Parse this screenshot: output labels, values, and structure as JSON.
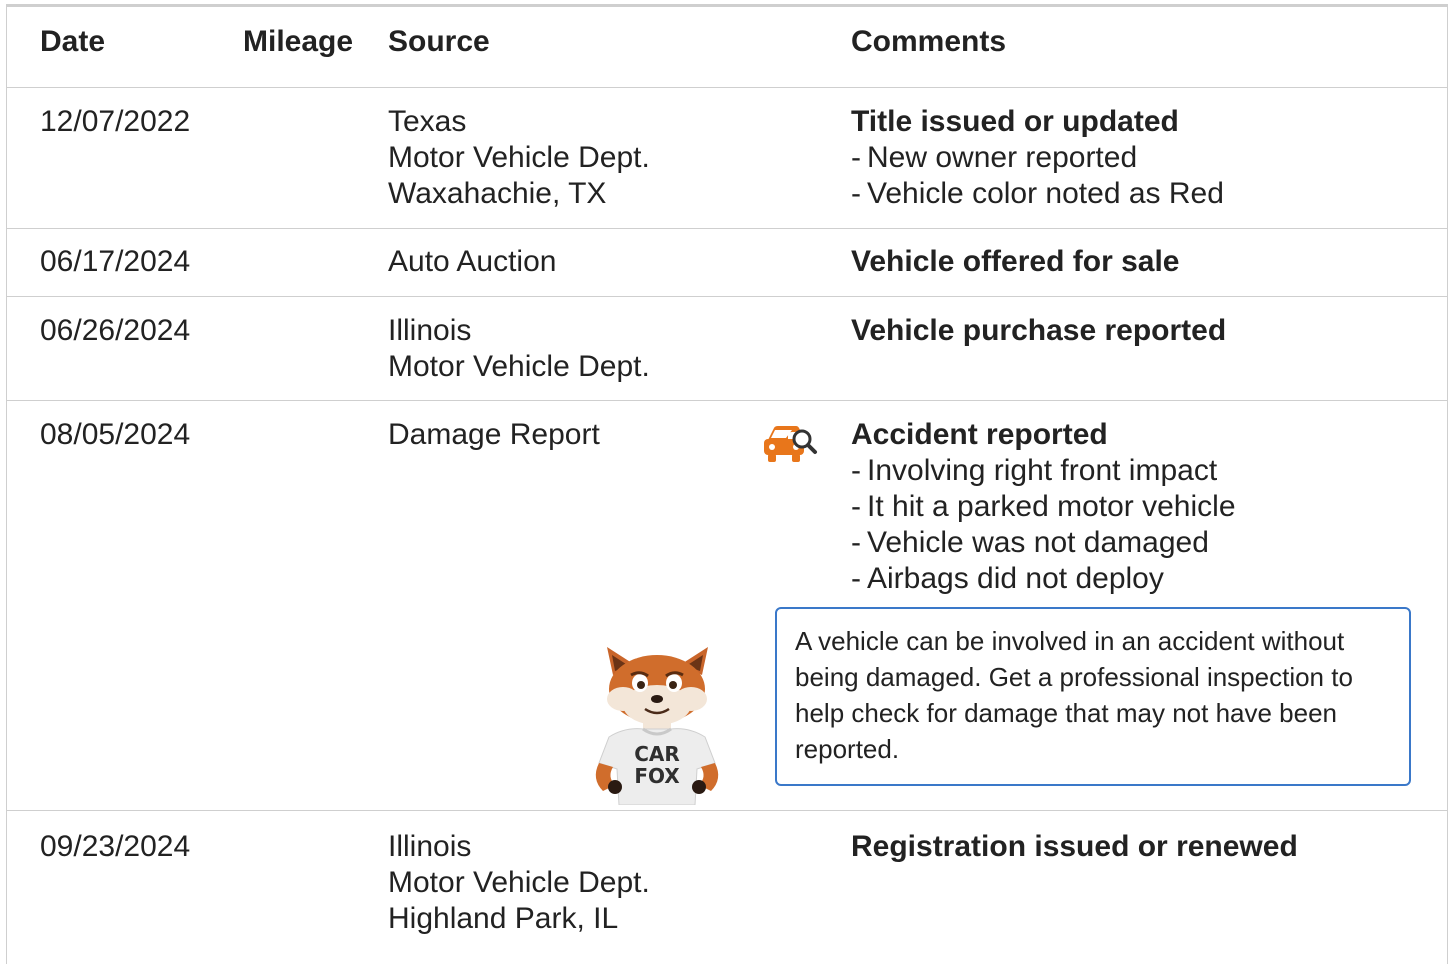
{
  "headers": {
    "date": "Date",
    "mileage": "Mileage",
    "source": "Source",
    "comments": "Comments"
  },
  "rows": [
    {
      "date": "12/07/2022",
      "mileage": "",
      "source": [
        "Texas",
        "Motor Vehicle Dept.",
        "Waxahachie, TX"
      ],
      "title": "Title issued or updated",
      "details": [
        "New owner reported",
        "Vehicle color noted as Red"
      ]
    },
    {
      "date": "06/17/2024",
      "mileage": "",
      "source": [
        "Auto Auction"
      ],
      "title": "Vehicle offered for sale",
      "details": []
    },
    {
      "date": "06/26/2024",
      "mileage": "",
      "source": [
        "Illinois",
        "Motor Vehicle Dept."
      ],
      "title": "Vehicle purchase reported",
      "details": []
    },
    {
      "date": "08/05/2024",
      "mileage": "",
      "source": [
        "Damage Report"
      ],
      "title": "Accident reported",
      "details": [
        "Involving right front impact",
        "It hit a parked motor vehicle",
        "Vehicle was not damaged",
        "Airbags did not deploy"
      ],
      "icon": "car-damage-search-icon",
      "callout": "A vehicle can be involved in an accident without being damaged. Get a professional inspection to help check for damage that may not have been reported."
    },
    {
      "date": "09/23/2024",
      "mileage": "",
      "source": [
        "Illinois",
        "Motor Vehicle Dept.",
        "Highland Park, IL"
      ],
      "title": "Registration issued or renewed",
      "details": []
    }
  ],
  "mascot": {
    "shirt_line1": "CAR",
    "shirt_line2": "FOX"
  },
  "colors": {
    "border": "#cfcfcf",
    "callout_border": "#3a78c9",
    "icon_orange": "#e8761b"
  },
  "dash": "-"
}
